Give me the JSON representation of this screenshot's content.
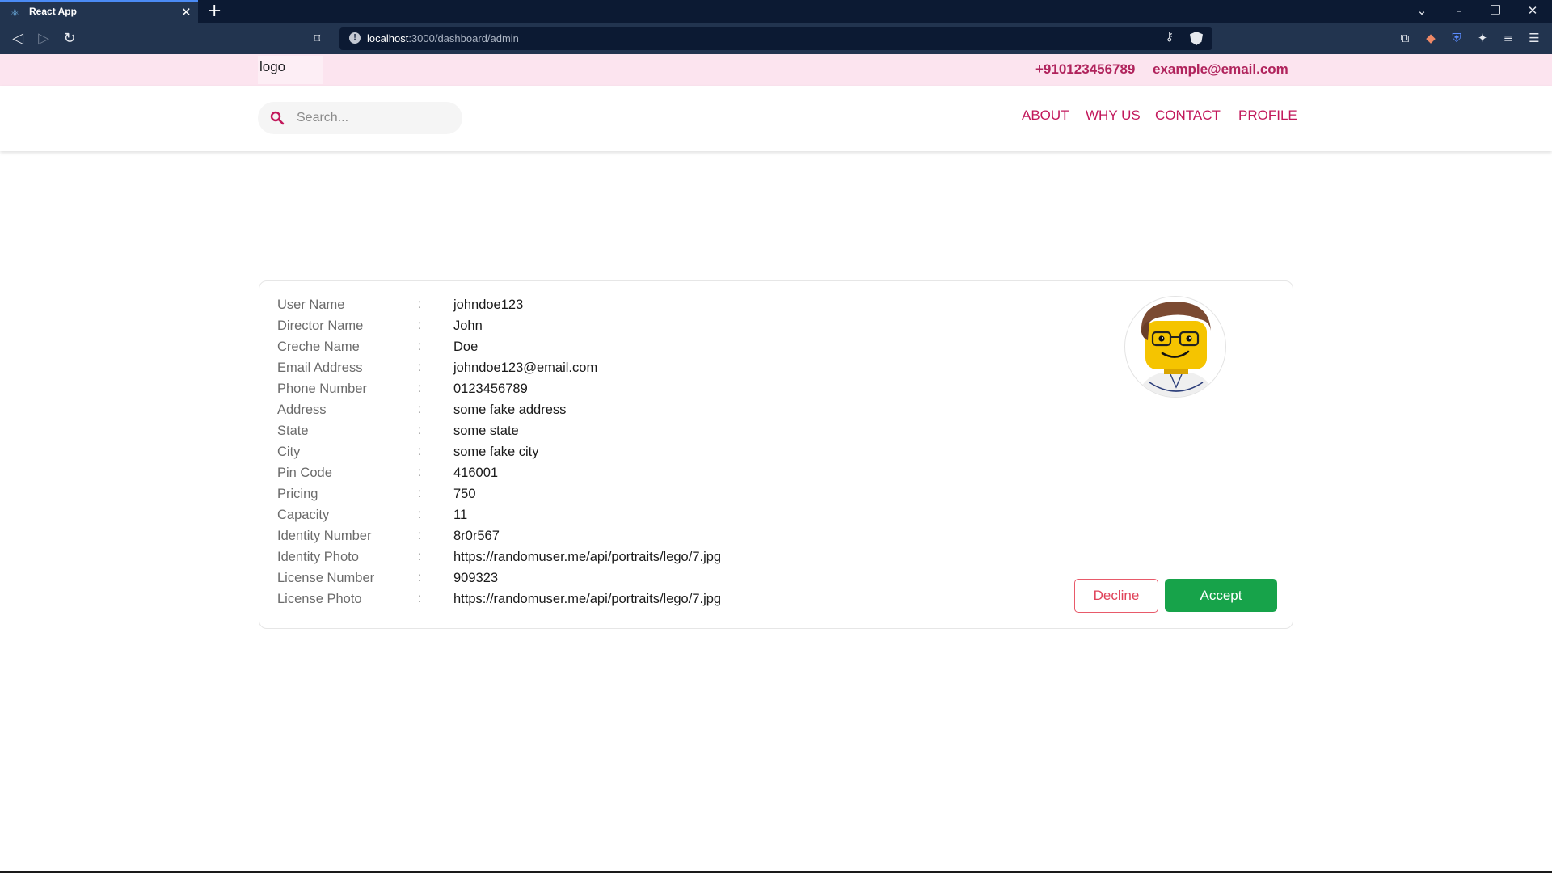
{
  "browser": {
    "tab_title": "React App",
    "url_host": "localhost",
    "url_rest": ":3000/dashboard/admin"
  },
  "topbar": {
    "logo_alt": "logo",
    "phone": "+910123456789",
    "email": "example@email.com"
  },
  "navbar": {
    "search_placeholder": "Search...",
    "links": [
      "ABOUT",
      "WHY US",
      "CONTACT",
      "PROFILE"
    ]
  },
  "details": [
    {
      "label": "User Name",
      "value": "johndoe123"
    },
    {
      "label": "Director Name",
      "value": "John"
    },
    {
      "label": "Creche Name",
      "value": "Doe"
    },
    {
      "label": "Email Address",
      "value": "johndoe123@email.com"
    },
    {
      "label": "Phone Number",
      "value": "0123456789"
    },
    {
      "label": "Address",
      "value": "some fake address"
    },
    {
      "label": "State",
      "value": "some state"
    },
    {
      "label": "City",
      "value": "some fake city"
    },
    {
      "label": "Pin Code",
      "value": "416001"
    },
    {
      "label": "Pricing",
      "value": "750"
    },
    {
      "label": "Capacity",
      "value": "11"
    },
    {
      "label": "Identity Number",
      "value": "8r0r567"
    },
    {
      "label": "Identity Photo",
      "value": "https://randomuser.me/api/portraits/lego/7.jpg"
    },
    {
      "label": "License Number",
      "value": "909323"
    },
    {
      "label": "License Photo",
      "value": "https://randomuser.me/api/portraits/lego/7.jpg"
    }
  ],
  "separator": ":",
  "actions": {
    "decline_label": "Decline",
    "accept_label": "Accept"
  },
  "colors": {
    "accent": "#c2185b",
    "topstrip": "#fce4ef",
    "accept": "#17a34a",
    "decline": "#e0435a"
  },
  "icons": [
    "react-favicon-icon",
    "close-icon",
    "plus-icon",
    "back-icon",
    "forward-icon",
    "reload-icon",
    "bookmark-icon",
    "info-icon",
    "key-icon",
    "brave-shield-icon",
    "search-icon",
    "avatar-image"
  ]
}
